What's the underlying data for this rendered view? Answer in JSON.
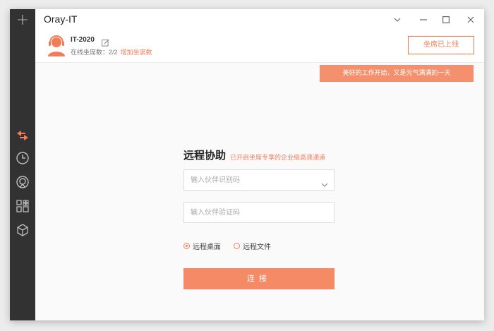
{
  "window": {
    "title": "Oray-IT",
    "controls": [
      "chevron-down-icon",
      "minimize-icon",
      "maximize-icon",
      "close-icon"
    ]
  },
  "sidebar": {
    "items": [
      {
        "icon": "plus-icon"
      },
      {
        "icon": "remote-arrows-icon",
        "active": true,
        "color": "#f27c57"
      },
      {
        "icon": "clock-icon"
      },
      {
        "icon": "signal-icon"
      },
      {
        "icon": "apps-grid-icon"
      },
      {
        "icon": "cube-icon"
      }
    ]
  },
  "header": {
    "seat_name": "IT-2020",
    "online_seats_label": "在线坐席数：",
    "online_seats_value": "2/2",
    "add_seat_label": "增加坐席数",
    "online_button": "坐席已上线",
    "banner": "美好的工作开始，又是元气满满的一天"
  },
  "main": {
    "title": "远程协助",
    "subtitle": "已开启坐席专享的企业级高速通道",
    "partner_id_placeholder": "输入伙伴识别码",
    "partner_code_placeholder": "输入伙伴验证码",
    "radio_options": [
      {
        "label": "远程桌面",
        "checked": true
      },
      {
        "label": "远程文件",
        "checked": false
      }
    ],
    "connect_button": "连接"
  },
  "colors": {
    "accent": "#f27c57",
    "sidebar": "#323232",
    "banner": "#f5906e",
    "button": "#f58a67"
  }
}
